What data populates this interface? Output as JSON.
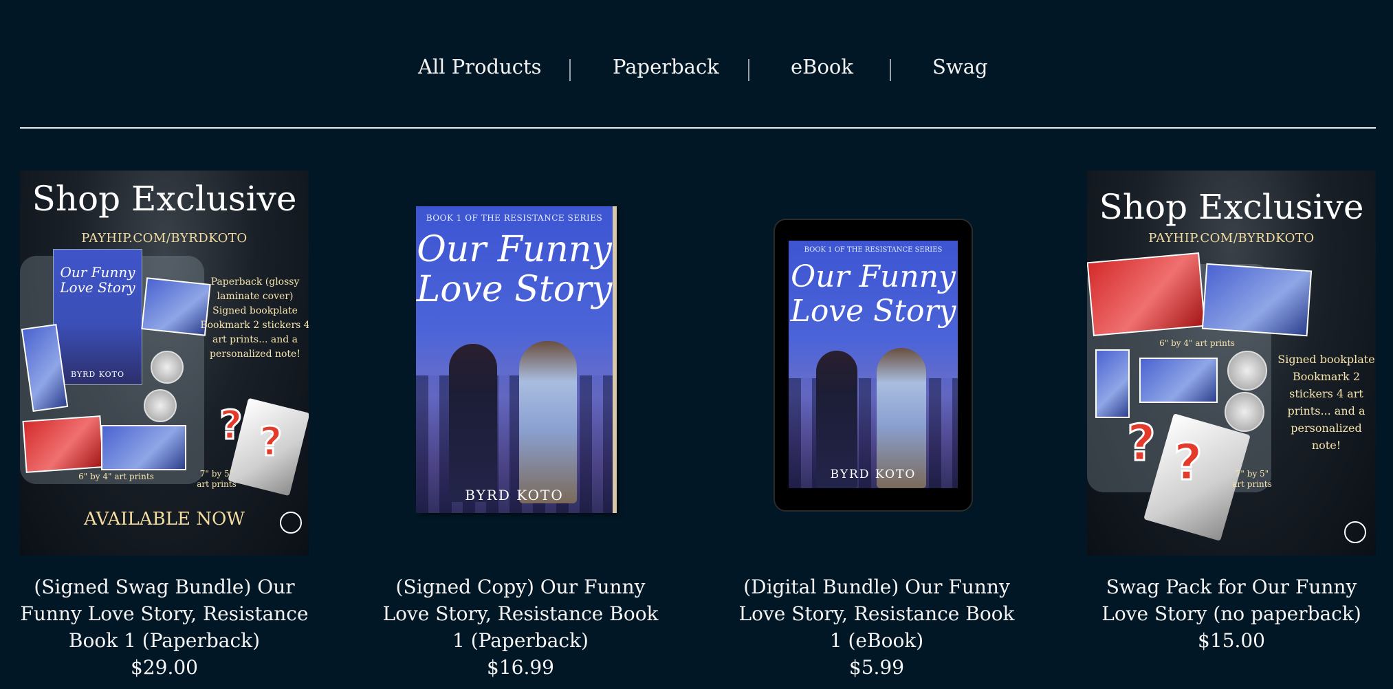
{
  "nav": {
    "items": [
      "All Products",
      "Paperback",
      "eBook",
      "Swag"
    ]
  },
  "products": [
    {
      "title": "(Signed Swag Bundle) Our Funny Love Story, Resistance Book 1 (Paperback)",
      "price": "$29.00",
      "image": {
        "heading": "Shop Exclusive",
        "site": "PAYHIP.COM/BYRDKOTO",
        "contents": "Paperback (glossy laminate cover) Signed bookplate Bookmark 2 stickers 4 art prints... and a personalized note!",
        "print_note": "6\" by 4\" art prints",
        "print_note2": "7\" by 5\" art prints",
        "footer": "AVAILABLE NOW",
        "cover_title": "Our Funny Love Story",
        "cover_author": "BYRD KOTO"
      }
    },
    {
      "title": "(Signed Copy) Our Funny Love Story, Resistance Book 1 (Paperback)",
      "price": "$16.99",
      "image": {
        "series": "BOOK 1 OF THE RESISTANCE SERIES",
        "cover_title_1": "Our Funny",
        "cover_title_2": "Love Story",
        "author": "BYRD KOTO"
      }
    },
    {
      "title": "(Digital Bundle) Our Funny Love Story, Resistance Book 1 (eBook)",
      "price": "$5.99",
      "image": {
        "series": "BOOK 1 OF THE RESISTANCE SERIES",
        "cover_title_1": "Our Funny",
        "cover_title_2": "Love Story",
        "author": "BYRD KOTO"
      }
    },
    {
      "title": "Swag Pack for Our Funny Love Story (no paperback)",
      "price": "$15.00",
      "image": {
        "heading": "Shop Exclusive",
        "site": "PAYHIP.COM/BYRDKOTO",
        "contents": "Signed bookplate Bookmark 2 stickers 4 art prints... and a personalized note!",
        "print_note": "6\" by 4\" art prints",
        "print_note2": "7\" by 5\" art prints"
      }
    }
  ],
  "colors": {
    "background": "#021725",
    "text": "#f5f5f5",
    "accent_gold": "#f3dca0"
  }
}
